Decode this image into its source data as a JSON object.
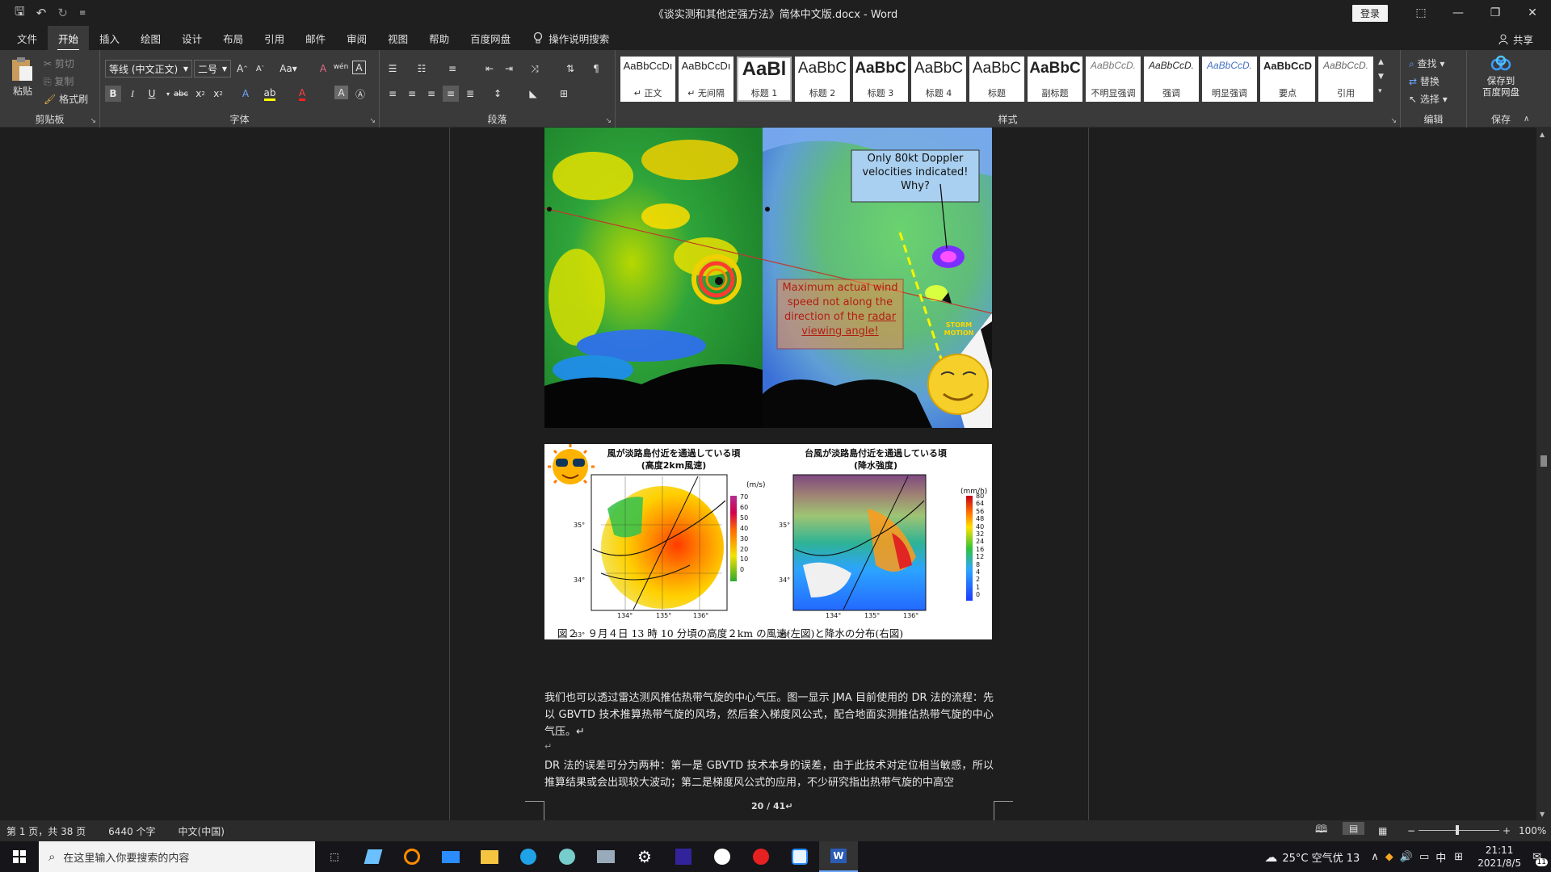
{
  "window": {
    "title": "《谈实测和其他定强方法》简体中文版.docx - Word",
    "login": "登录"
  },
  "tabs": [
    "文件",
    "开始",
    "插入",
    "绘图",
    "设计",
    "布局",
    "引用",
    "邮件",
    "审阅",
    "视图",
    "帮助",
    "百度网盘"
  ],
  "tellme": "操作说明搜索",
  "share": "共享",
  "ribbon": {
    "clipboard": {
      "label": "剪贴板",
      "paste": "粘贴",
      "cut": "剪切",
      "copy": "复制",
      "painter": "格式刷"
    },
    "font": {
      "label": "字体",
      "name": "等线 (中文正文)",
      "size": "二号",
      "wen": "wén"
    },
    "paragraph": {
      "label": "段落"
    },
    "styles": {
      "label": "样式",
      "items": [
        {
          "preview": "AaBbCcDı",
          "name": "↵ 正文"
        },
        {
          "preview": "AaBbCcDı",
          "name": "↵ 无间隔"
        },
        {
          "preview": "AaBl",
          "name": "标题 1"
        },
        {
          "preview": "AaBbC",
          "name": "标题 2"
        },
        {
          "preview": "AaBbC",
          "name": "标题 3"
        },
        {
          "preview": "AaBbC",
          "name": "标题 4"
        },
        {
          "preview": "AaBbC",
          "name": "标题"
        },
        {
          "preview": "AaBbC",
          "name": "副标题"
        },
        {
          "preview": "AaBbCcD.",
          "name": "不明显强调"
        },
        {
          "preview": "AaBbCcD.",
          "name": "强调"
        },
        {
          "preview": "AaBbCcD.",
          "name": "明显强调"
        },
        {
          "preview": "AaBbCcD",
          "name": "要点"
        },
        {
          "preview": "AaBbCcD.",
          "name": "引用"
        }
      ]
    },
    "editing": {
      "label": "编辑",
      "find": "查找",
      "replace": "替换",
      "select": "选择"
    },
    "save": {
      "label": "保存",
      "btn1": "保存到",
      "btn2": "百度网盘"
    }
  },
  "figure1": {
    "callout1": "Only 80kt Doppler velocities indicated! Why?",
    "callout2_a": "Maximum actual wind speed not along the direction of the ",
    "callout2_b": "radar viewing angle!",
    "storm": "STORM MOTION"
  },
  "figure2": {
    "left_title_1": "風が淡路島付近を通過している頃",
    "left_title_2": "(高度2km風速)",
    "right_title_1": "台風が淡路島付近を通過している頃",
    "right_title_2": "(降水強度)",
    "left_unit": "(m/s)",
    "right_unit": "(mm/h)",
    "left_scale": [
      "70",
      "60",
      "50",
      "40",
      "30",
      "20",
      "10",
      "0"
    ],
    "right_scale": [
      "80",
      "64",
      "56",
      "48",
      "40",
      "32",
      "24",
      "16",
      "12",
      "8",
      "4",
      "2",
      "1",
      "0"
    ],
    "lat": [
      "35°",
      "34°",
      "33°"
    ],
    "lon": [
      "134°",
      "135°",
      "136°"
    ],
    "caption": "図２　９月４日 13 時 10 分頃の高度２km の風速(左図)と降水の分布(右図)"
  },
  "paragraphs": [
    "我们也可以透过雷达测风推估热带气旋的中心气压。图一显示 JMA 目前使用的 DR 法的流程：先以 GBVTD 技术推算热带气旋的风场，然后套入梯度风公式，配合地面实测推估热带气旋的中心气压。↵",
    "↵",
    "DR 法的误差可分为两种：第一是 GBVTD 技术本身的误差，由于此技术对定位相当敏感，所以推算结果或会出现较大波动；第二是梯度风公式的应用，不少研究指出热带气旋的中高空"
  ],
  "pagenum": "20 / 41↵",
  "status": {
    "page": "第 1 页，共 38 页",
    "words": "6440 个字",
    "lang": "中文(中国)",
    "zoom": "100%"
  },
  "taskbar": {
    "search": "在这里输入你要搜索的内容",
    "weather": "25°C 空气优 13",
    "ime": "中",
    "time": "21:11",
    "date": "2021/8/5",
    "notif": "11"
  }
}
